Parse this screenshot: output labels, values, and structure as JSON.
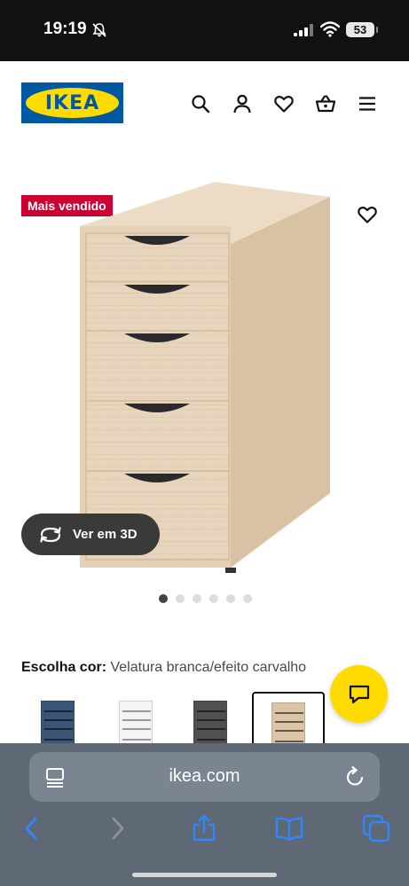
{
  "status_bar": {
    "time": "19:19",
    "battery": "53"
  },
  "header": {
    "logo_text": "IKEA",
    "icons": [
      "search-icon",
      "account-icon",
      "favourites-icon",
      "cart-icon",
      "menu-icon"
    ]
  },
  "product": {
    "badge": "Mais vendido",
    "view_3d_label": "Ver em 3D",
    "gallery": {
      "total_images": 6,
      "active_index": 0
    },
    "color_label": "Escolha cor:",
    "color_value": "Velatura branca/efeito carvalho",
    "swatches": [
      {
        "color": "#3b5577",
        "selected": false
      },
      {
        "color": "#f4f4f2",
        "selected": false
      },
      {
        "color": "#505050",
        "selected": false
      },
      {
        "color": "#dcc5a6",
        "selected": true
      }
    ]
  },
  "browser": {
    "url": "ikea.com"
  },
  "colors": {
    "ikea_blue": "#0058a3",
    "ikea_yellow": "#ffdb00",
    "badge_red": "#cc0033"
  }
}
